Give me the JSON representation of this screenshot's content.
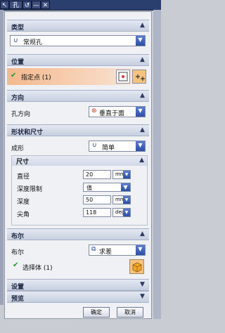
{
  "toolbar": {
    "title": "孔",
    "btn1": "↖",
    "btn2": "↺",
    "btn3": "—",
    "btn4": "✕"
  },
  "type_section": {
    "header": "类型",
    "selected": "常规孔"
  },
  "position_section": {
    "header": "位置",
    "label": "指定点 (1)"
  },
  "direction_section": {
    "header": "方向",
    "label": "孔方向",
    "selected": "垂直于面"
  },
  "shape_section": {
    "header": "形状和尺寸",
    "form_label": "成形",
    "form_selected": "简单",
    "size_header": "尺寸",
    "fields": [
      {
        "label": "直径",
        "value": "20",
        "unit": "mm"
      },
      {
        "label": "深度限制",
        "value": "值",
        "unit": ""
      },
      {
        "label": "深度",
        "value": "50",
        "unit": "mm"
      },
      {
        "label": "尖角",
        "value": "118",
        "unit": "deg"
      }
    ]
  },
  "boolean_section": {
    "header": "布尔",
    "label": "布尔",
    "selected": "求差",
    "select_body": "选择体 (1)"
  },
  "settings_section": {
    "header": "设置"
  },
  "preview_section": {
    "header": "预览"
  },
  "buttons": {
    "ok": "确定",
    "cancel": "取消"
  }
}
